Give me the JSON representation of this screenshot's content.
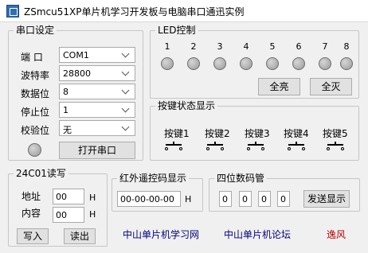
{
  "window": {
    "title": "ZSmcu51XP单片机学习开发板与电脑串口通迅实例"
  },
  "serial": {
    "group_title": "串口设定",
    "port_label": "端  口",
    "port_value": "COM1",
    "baud_label": "波特率",
    "baud_value": "28800",
    "databits_label": "数据位",
    "databits_value": "8",
    "stopbits_label": "停止位",
    "stopbits_value": "1",
    "parity_label": "校验位",
    "parity_value": "无",
    "open_button": "打开串口"
  },
  "led": {
    "group_title": "LED控制",
    "numbers": [
      "1",
      "2",
      "3",
      "4",
      "5",
      "6",
      "7",
      "8"
    ],
    "all_on_button": "全亮",
    "all_off_button": "全灭"
  },
  "keys": {
    "group_title": "按键状态显示",
    "labels": [
      "按键1",
      "按键2",
      "按键3",
      "按键4",
      "按键5"
    ]
  },
  "eeprom": {
    "group_title": "24C01读写",
    "address_label": "地址",
    "address_value": "00",
    "content_label": "内容",
    "content_value": "00",
    "hex_suffix": "H",
    "write_button": "写入",
    "read_button": "读出"
  },
  "ir": {
    "group_title": "红外遥控码显示",
    "code_value": "00-00-00-00",
    "hex_suffix": "H"
  },
  "digits": {
    "group_title": "四位数码管",
    "values": [
      "0",
      "0",
      "0",
      "0"
    ],
    "send_button": "发送显示"
  },
  "footer": {
    "link1": "中山单片机学习网",
    "link2": "中山单片机论坛",
    "brand": "逸风"
  },
  "colors": {
    "link": "#00007f",
    "brand": "#c00000",
    "window_bg": "#f0f0f0"
  }
}
